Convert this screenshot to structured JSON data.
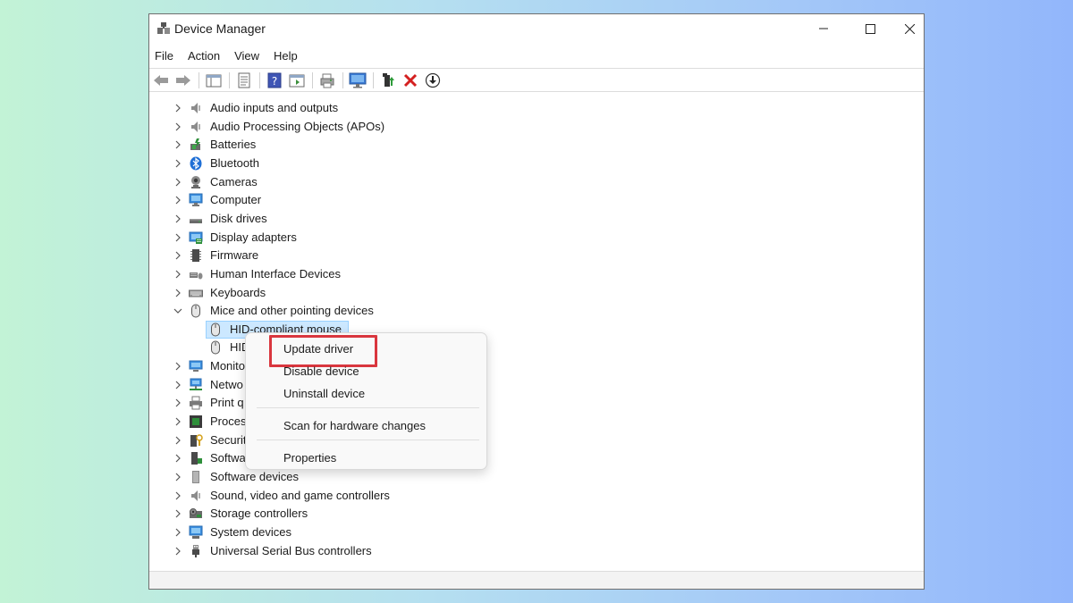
{
  "window": {
    "title": "Device Manager",
    "menu": [
      "File",
      "Action",
      "View",
      "Help"
    ]
  },
  "toolbar": {
    "buttons": [
      "back-arrow-icon",
      "forward-arrow-icon",
      "show-hide-console-tree-icon",
      "properties-icon",
      "help-icon",
      "action-pane-icon",
      "print-icon",
      "scan-monitor-icon",
      "update-driver-icon",
      "uninstall-icon",
      "download-icon"
    ]
  },
  "tree": {
    "items": [
      {
        "label": "Audio inputs and outputs",
        "icon": "speaker-icon",
        "expanded": false
      },
      {
        "label": "Audio Processing Objects (APOs)",
        "icon": "speaker-icon",
        "expanded": false
      },
      {
        "label": "Batteries",
        "icon": "battery-icon",
        "expanded": false
      },
      {
        "label": "Bluetooth",
        "icon": "bluetooth-icon",
        "expanded": false
      },
      {
        "label": "Cameras",
        "icon": "camera-icon",
        "expanded": false
      },
      {
        "label": "Computer",
        "icon": "computer-icon",
        "expanded": false
      },
      {
        "label": "Disk drives",
        "icon": "disk-drive-icon",
        "expanded": false
      },
      {
        "label": "Display adapters",
        "icon": "display-adapter-icon",
        "expanded": false
      },
      {
        "label": "Firmware",
        "icon": "firmware-icon",
        "expanded": false
      },
      {
        "label": "Human Interface Devices",
        "icon": "hid-icon",
        "expanded": false
      },
      {
        "label": "Keyboards",
        "icon": "keyboard-icon",
        "expanded": false
      },
      {
        "label": "Mice and other pointing devices",
        "icon": "mouse-icon",
        "expanded": true
      },
      {
        "label": "Monito",
        "icon": "monitor-icon",
        "expanded": false
      },
      {
        "label": "Netwo",
        "icon": "network-icon",
        "expanded": false
      },
      {
        "label": "Print q",
        "icon": "printer-icon",
        "expanded": false
      },
      {
        "label": "Proces",
        "icon": "processor-icon",
        "expanded": false
      },
      {
        "label": "Securit",
        "icon": "security-icon",
        "expanded": false
      },
      {
        "label": "Softwa",
        "icon": "software-component-icon",
        "expanded": false
      },
      {
        "label": "Software devices",
        "icon": "software-device-icon",
        "expanded": false
      },
      {
        "label": "Sound, video and game controllers",
        "icon": "speaker-icon",
        "expanded": false
      },
      {
        "label": "Storage controllers",
        "icon": "storage-controller-icon",
        "expanded": false
      },
      {
        "label": "System devices",
        "icon": "system-device-icon",
        "expanded": false
      },
      {
        "label": "Universal Serial Bus controllers",
        "icon": "usb-icon",
        "expanded": false
      }
    ],
    "children": [
      {
        "label": "HID-compliant mouse",
        "icon": "mouse-icon",
        "selected": true
      },
      {
        "label": "HID",
        "icon": "mouse-icon",
        "selected": false
      }
    ]
  },
  "context_menu": {
    "items": [
      "Update driver",
      "Disable device",
      "Uninstall device",
      "Scan for hardware changes",
      "Properties"
    ],
    "highlighted": "Update driver",
    "highlight_color": "#d9363e"
  },
  "colors": {
    "selection": "#cce8ff",
    "selection_border": "#99d1ff",
    "uninstall_red": "#d42020"
  }
}
